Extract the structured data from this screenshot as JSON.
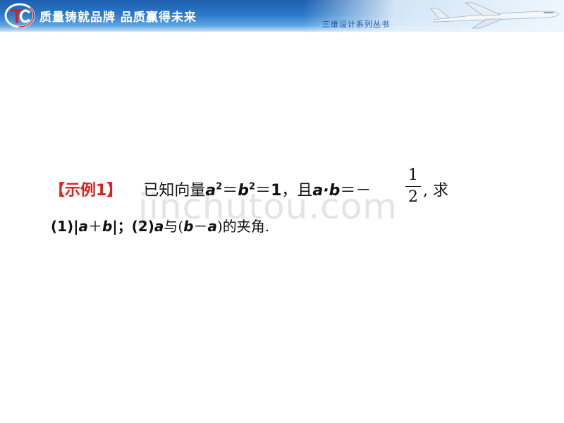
{
  "header": {
    "slogan": "质量铸就品牌 品质赢得未来",
    "series": "三维设计系列丛书",
    "colors": {
      "banner": "#2a78c8",
      "accent": "#e0201a"
    },
    "logo_icon": "tc-logo-icon",
    "plane_icon": "airplane-icon"
  },
  "watermark": "jinchutou.com",
  "problem": {
    "tag_open": "【示例",
    "tag_num": "1",
    "tag_close": "】",
    "t1": "已知向量",
    "a": "a",
    "sq": "2",
    "eq1": "＝",
    "b": "b",
    "sq2": "2",
    "eq2": "＝",
    "one": "1",
    "t2": "，且",
    "ab": "a·b",
    "eq3": "＝－",
    "frac_num": "1",
    "frac_den": "2",
    "tail": ", 求",
    "l2_p1": "(1)|",
    "l2_a": "a",
    "l2_plus": "＋",
    "l2_b": "b",
    "l2_p2": "|；(2)",
    "l2_a2": "a",
    "l2_t1": "与(",
    "l2_b2": "b",
    "l2_minus": "－",
    "l2_a3": "a",
    "l2_t2": ")的夹角."
  }
}
